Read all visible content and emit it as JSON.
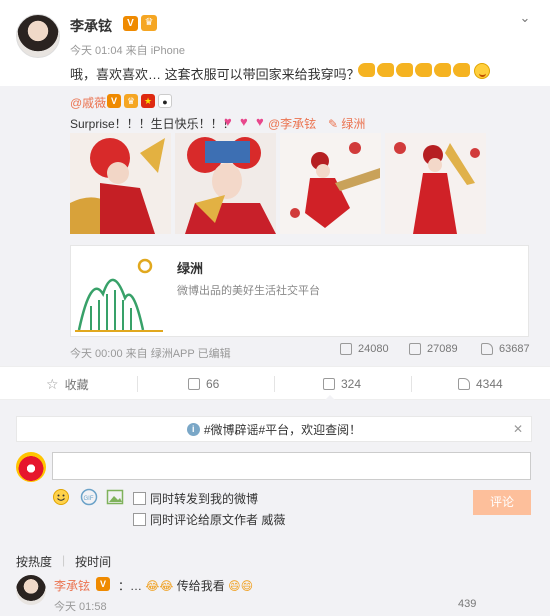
{
  "post": {
    "author": "李承铉",
    "meta": "今天 01:04 来自 iPhone",
    "text": "哦，喜欢喜欢… 这套衣服可以带回家来给我穿吗？"
  },
  "repost": {
    "author": "@戚薇",
    "text": "Surprise！！！生日快乐！！！",
    "mention": "@李承铉",
    "location": "绿洲",
    "card": {
      "title": "绿洲",
      "subtitle": "微博出品的美好生活社交平台"
    },
    "meta": "今天 00:00 来自 绿洲APP  已编辑",
    "reposts": "24080",
    "comments": "27089",
    "likes": "63687"
  },
  "actions": {
    "favorite": "收藏",
    "repost_count": "66",
    "comment_count": "324",
    "like_count": "4344"
  },
  "compose": {
    "notice": "#微博辟谣#平台，欢迎查阅！",
    "check_repost": "同时转发到我的微博",
    "check_comment": "同时评论给原文作者 威薇",
    "submit": "评论"
  },
  "comments": {
    "sort_hot": "按热度",
    "sort_time": "按时间",
    "items": [
      {
        "author": "李承铉",
        "text": "：…",
        "text2": "传给我看",
        "time": "今天 01:58",
        "likes": "439"
      }
    ]
  },
  "colors": {
    "accent": "#eb7350",
    "background": "#f2f2f5"
  }
}
